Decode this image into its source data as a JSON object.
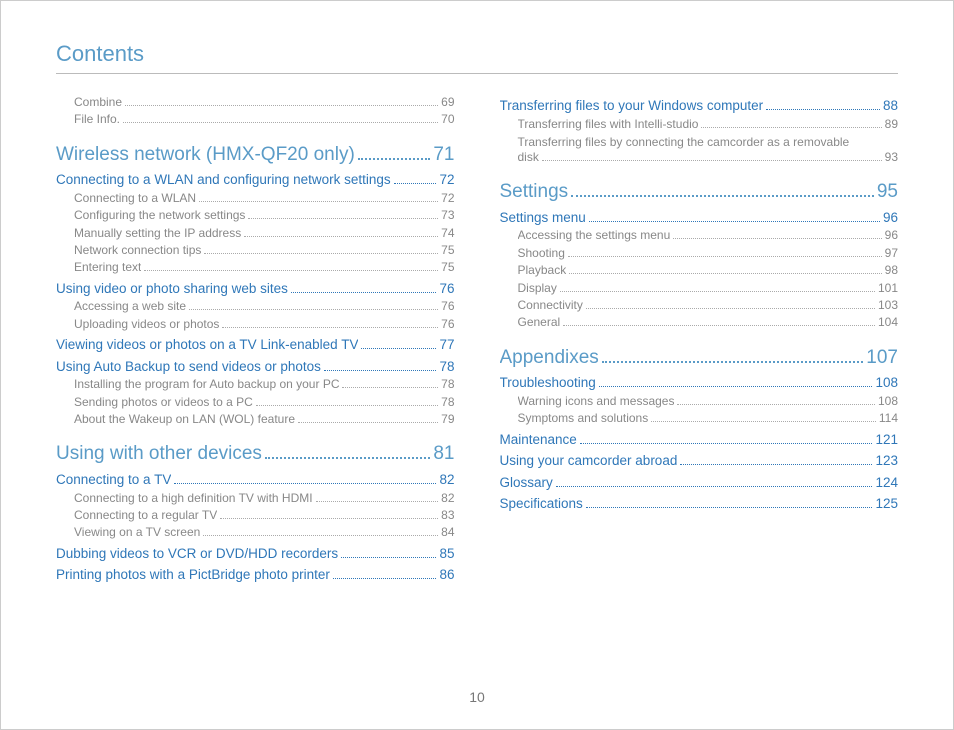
{
  "title": "Contents",
  "pageNumber": "10",
  "leftColumn": [
    {
      "type": "item",
      "label": "Combine",
      "page": "69"
    },
    {
      "type": "item",
      "label": "File Info.",
      "page": "70"
    },
    {
      "type": "section",
      "label": "Wireless network (HMX-QF20 only)",
      "page": "71"
    },
    {
      "type": "sub",
      "label": "Connecting to a WLAN and configuring network settings",
      "page": "72"
    },
    {
      "type": "item",
      "label": "Connecting to a WLAN",
      "page": "72"
    },
    {
      "type": "item",
      "label": "Configuring the network settings",
      "page": "73"
    },
    {
      "type": "item",
      "label": "Manually setting the IP address",
      "page": "74"
    },
    {
      "type": "item",
      "label": "Network connection tips",
      "page": "75"
    },
    {
      "type": "item",
      "label": "Entering text",
      "page": "75"
    },
    {
      "type": "sub",
      "label": "Using video or photo sharing web sites",
      "page": "76"
    },
    {
      "type": "item",
      "label": "Accessing a web site",
      "page": "76"
    },
    {
      "type": "item",
      "label": "Uploading videos or photos",
      "page": "76"
    },
    {
      "type": "sub",
      "label": "Viewing videos or photos on a TV Link-enabled TV",
      "page": "77"
    },
    {
      "type": "sub",
      "label": "Using Auto Backup to send videos or photos",
      "page": "78"
    },
    {
      "type": "item",
      "label": "Installing the program for Auto backup on your PC",
      "page": "78"
    },
    {
      "type": "item",
      "label": "Sending photos or videos to a PC",
      "page": "78"
    },
    {
      "type": "item",
      "label": "About the Wakeup on LAN (WOL) feature",
      "page": "79"
    },
    {
      "type": "section",
      "label": "Using with other devices",
      "page": "81"
    },
    {
      "type": "sub",
      "label": "Connecting to a TV",
      "page": "82"
    },
    {
      "type": "item",
      "label": "Connecting to a high definition TV with HDMI",
      "page": "82"
    },
    {
      "type": "item",
      "label": "Connecting to a regular TV",
      "page": "83"
    },
    {
      "type": "item",
      "label": "Viewing on a TV screen",
      "page": "84"
    },
    {
      "type": "sub",
      "label": "Dubbing videos to VCR or DVD/HDD recorders",
      "page": "85"
    },
    {
      "type": "sub",
      "label": "Printing photos with a PictBridge photo printer",
      "page": "86"
    }
  ],
  "rightColumn": [
    {
      "type": "sub",
      "label": "Transferring files to your Windows computer",
      "page": "88"
    },
    {
      "type": "item",
      "label": "Transferring files with Intelli-studio",
      "page": "89"
    },
    {
      "type": "item-wrap",
      "label": "Transferring files by connecting the camcorder as a removable disk",
      "page": "93"
    },
    {
      "type": "section",
      "label": "Settings",
      "page": "95"
    },
    {
      "type": "sub",
      "label": "Settings menu",
      "page": "96"
    },
    {
      "type": "item",
      "label": "Accessing the settings menu",
      "page": "96"
    },
    {
      "type": "item",
      "label": "Shooting",
      "page": "97"
    },
    {
      "type": "item",
      "label": "Playback",
      "page": "98"
    },
    {
      "type": "item",
      "label": "Display",
      "page": "101"
    },
    {
      "type": "item",
      "label": "Connectivity",
      "page": "103"
    },
    {
      "type": "item",
      "label": "General",
      "page": "104"
    },
    {
      "type": "section",
      "label": "Appendixes",
      "page": "107"
    },
    {
      "type": "sub",
      "label": "Troubleshooting",
      "page": "108"
    },
    {
      "type": "item",
      "label": "Warning icons and messages",
      "page": "108"
    },
    {
      "type": "item",
      "label": "Symptoms and solutions",
      "page": "114"
    },
    {
      "type": "sub",
      "label": "Maintenance",
      "page": "121"
    },
    {
      "type": "sub",
      "label": "Using your camcorder abroad",
      "page": "123"
    },
    {
      "type": "sub",
      "label": "Glossary",
      "page": "124"
    },
    {
      "type": "sub",
      "label": "Specifications",
      "page": "125"
    }
  ]
}
